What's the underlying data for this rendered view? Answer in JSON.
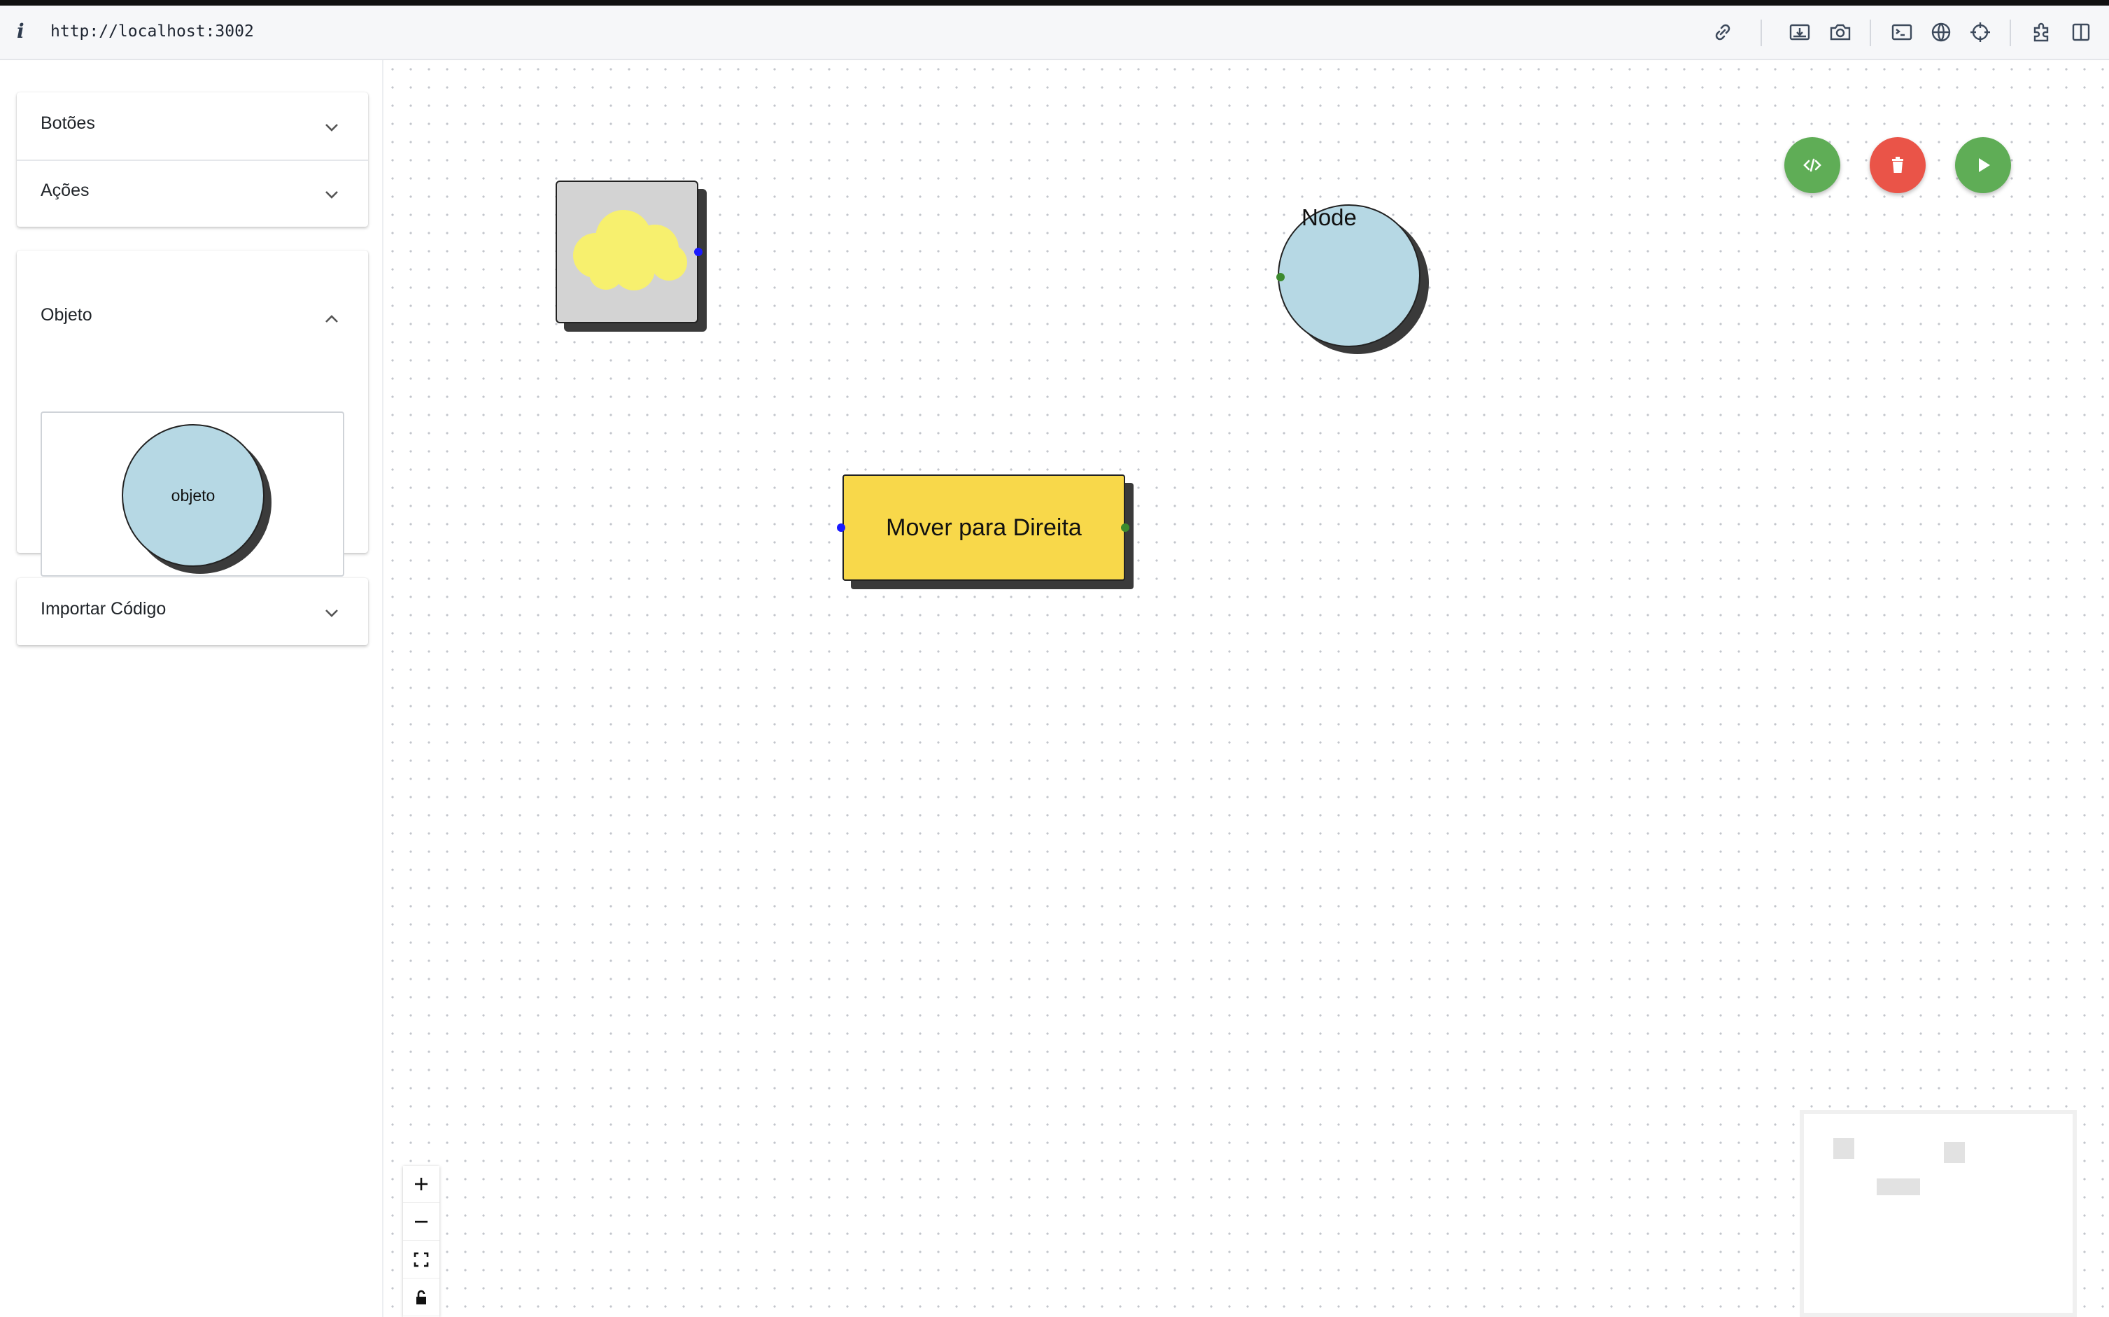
{
  "browser": {
    "info_glyph": "i",
    "url": "http://localhost:3002",
    "icons": [
      "link-icon",
      "download-icon",
      "camera-icon",
      "terminal-icon",
      "globe-icon",
      "crosshair-icon",
      "extension-icon",
      "sidebar-toggle-icon"
    ]
  },
  "sidebar": {
    "sections": [
      {
        "label": "Botões",
        "expanded": false
      },
      {
        "label": "Ações",
        "expanded": false
      },
      {
        "label": "Objeto",
        "expanded": true
      },
      {
        "label": "Importar Código",
        "expanded": false
      }
    ],
    "object_preview_label": "objeto"
  },
  "canvas": {
    "fab_buttons": [
      {
        "name": "code",
        "color": "#5fad56"
      },
      {
        "name": "delete",
        "color": "#ea5448"
      },
      {
        "name": "run",
        "color": "#5fad56"
      }
    ],
    "nodes": {
      "image_node": {
        "type": "image",
        "icon": "cloud-icon"
      },
      "object_node": {
        "label": "Node"
      },
      "action_node": {
        "label": "Mover para Direita"
      }
    },
    "controls": [
      "zoom-in",
      "zoom-out",
      "fit-view",
      "lock"
    ]
  },
  "colors": {
    "object_fill": "#b6d8e4",
    "action_fill": "#f8d84a",
    "cloud_fill": "#f7f06e",
    "handle_source": "#1a1aff",
    "handle_target": "#3c8a2e"
  }
}
